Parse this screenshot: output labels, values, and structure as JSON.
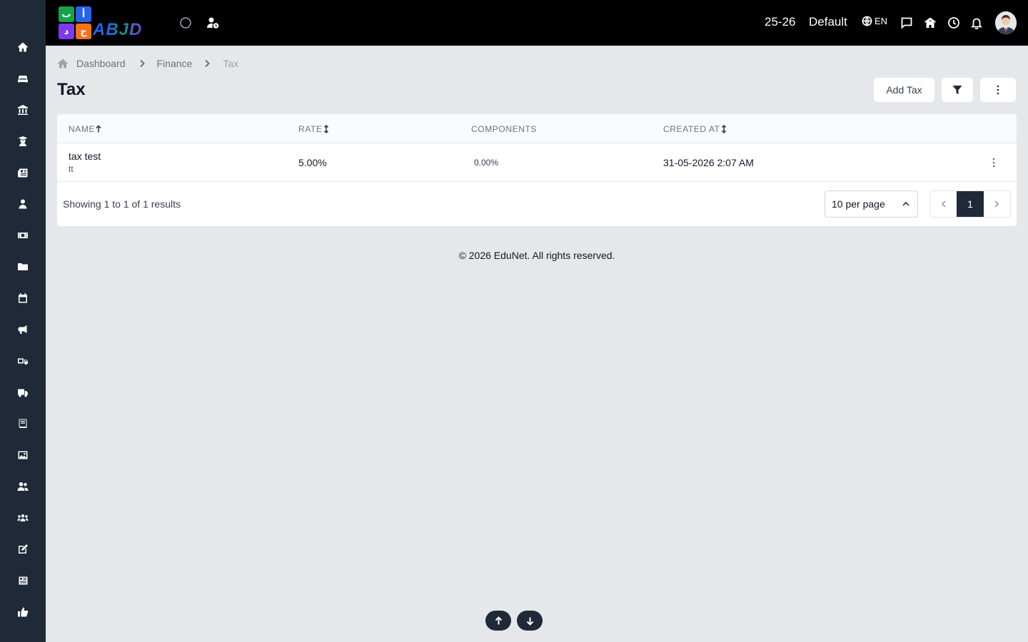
{
  "header": {
    "logo_tiles": [
      "ب",
      "أ",
      "ج",
      "د"
    ],
    "logo_text": "ABJD",
    "year": "25-26",
    "profile": "Default",
    "language": "EN"
  },
  "breadcrumb": {
    "items": [
      "Dashboard",
      "Finance",
      "Tax"
    ]
  },
  "page": {
    "title": "Tax",
    "add_label": "Add Tax"
  },
  "table": {
    "columns": [
      "NAME",
      "RATE",
      "COMPONENTS",
      "CREATED AT"
    ],
    "rows": [
      {
        "name": "tax test",
        "subtitle": "tt",
        "rate": "5.00%",
        "components": "0.00%",
        "created_at": "31-05-2026 2:07 AM"
      }
    ],
    "results_text": "Showing 1 to 1 of 1 results",
    "per_page": "10 per page",
    "current_page": "1"
  },
  "footer": {
    "copyright": "© 2026 EduNet. All rights reserved."
  },
  "colors": {
    "sidebar": "#1f2937",
    "topbar": "#000000",
    "background": "#e5e7eb",
    "active_page": "#1f2937"
  }
}
